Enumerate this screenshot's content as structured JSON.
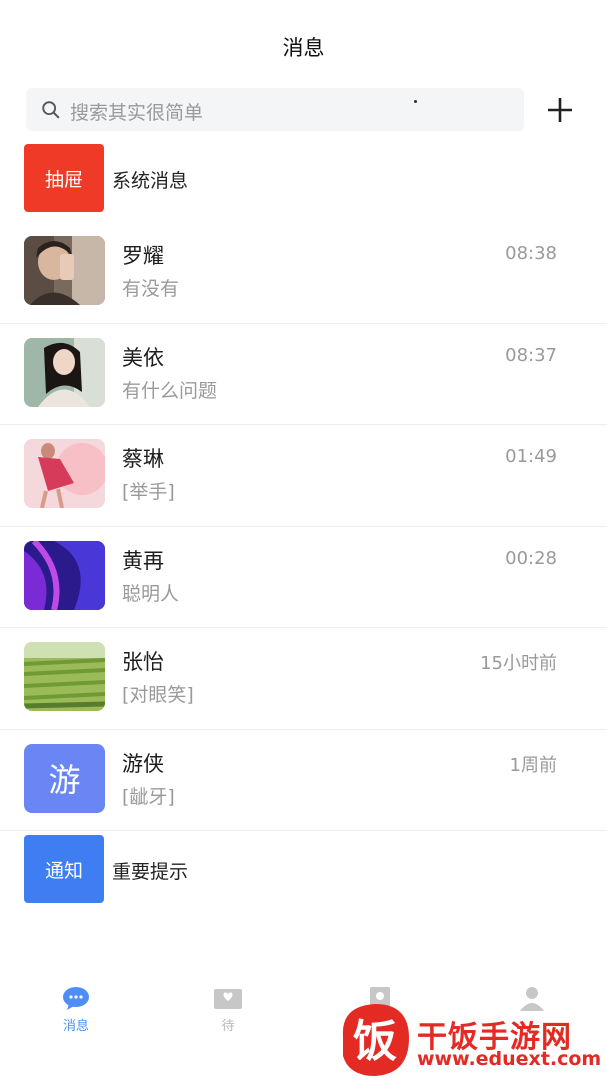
{
  "header": {
    "title": "消息"
  },
  "search": {
    "placeholder": "搜索其实很简单"
  },
  "system": {
    "tag": "抽屉",
    "label": "系统消息"
  },
  "chats": [
    {
      "name": "罗耀",
      "message": "有没有",
      "time": "08:38",
      "avatar": "photo-portrait-man"
    },
    {
      "name": "美依",
      "message": "有什么问题",
      "time": "08:37",
      "avatar": "photo-portrait-woman"
    },
    {
      "name": "蔡琳",
      "message": "[举手]",
      "time": "01:49",
      "avatar": "photo-dancer-pink"
    },
    {
      "name": "黄再",
      "message": "聪明人",
      "time": "00:28",
      "avatar": "photo-abstract-purple"
    },
    {
      "name": "张怡",
      "message": "[对眼笑]",
      "time": "15小时前",
      "avatar": "photo-green-field"
    },
    {
      "name": "游侠",
      "message": "[龇牙]",
      "time": "1周前",
      "avatar": "letter-avatar",
      "avatar_text": "游",
      "avatar_color": "#6a86f5"
    }
  ],
  "notice": {
    "tag": "通知",
    "label": "重要提示"
  },
  "tabs": [
    {
      "label": "消息",
      "icon": "chat-bubble-icon",
      "active": true
    },
    {
      "label": "待",
      "icon": "envelope-heart-icon",
      "active": false
    },
    {
      "label": "",
      "icon": "contacts-icon",
      "active": false
    },
    {
      "label": "",
      "icon": "profile-icon",
      "active": false
    }
  ],
  "watermark": {
    "text": "干饭手游网",
    "url": "www.eduext.com",
    "logo_char": "饭"
  },
  "colors": {
    "accent": "#4e8ff7",
    "system_red": "#ee3a26",
    "notice_blue": "#3f7ef2",
    "watermark_red": "#e32a23"
  }
}
